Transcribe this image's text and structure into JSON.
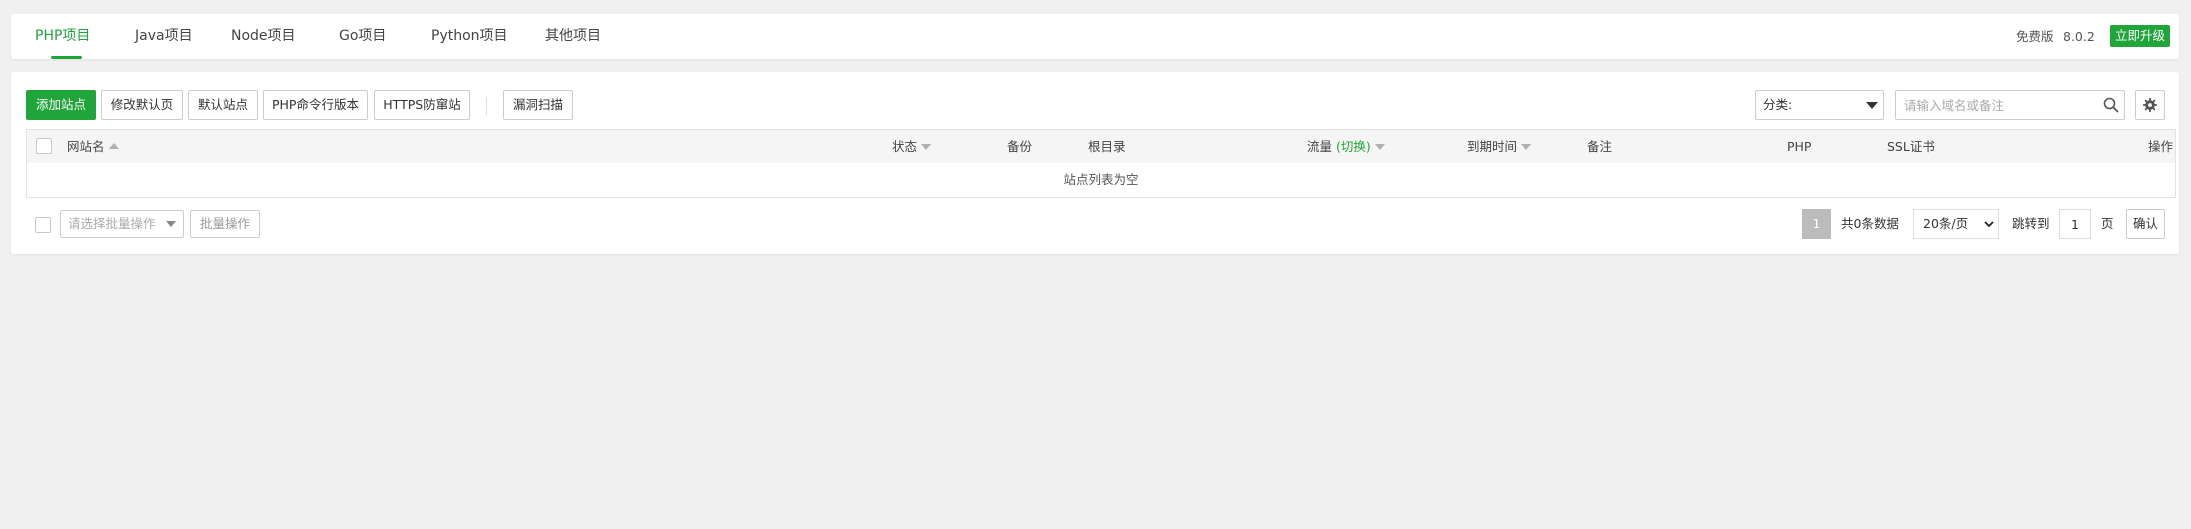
{
  "tabs": [
    {
      "label": "PHP项目",
      "active": true
    },
    {
      "label": "Java项目",
      "active": false
    },
    {
      "label": "Node项目",
      "active": false
    },
    {
      "label": "Go项目",
      "active": false
    },
    {
      "label": "Python项目",
      "active": false
    },
    {
      "label": "其他项目",
      "active": false
    }
  ],
  "version": {
    "edition": "免费版",
    "number": "8.0.2",
    "upgrade_label": "立即升级"
  },
  "toolbar": {
    "add_site": "添加站点",
    "edit_default_page": "修改默认页",
    "default_site": "默认站点",
    "php_cli_version": "PHP命令行版本",
    "https_protection": "HTTPS防窜站",
    "vuln_scan": "漏洞扫描",
    "category_label": "分类:",
    "search_placeholder": "请输入域名或备注"
  },
  "table": {
    "columns": {
      "site_name": "网站名",
      "status": "状态",
      "backup": "备份",
      "root_dir": "根目录",
      "traffic": "流量",
      "traffic_toggle": "(切换)",
      "expire_time": "到期时间",
      "remark": "备注",
      "php": "PHP",
      "ssl": "SSL证书",
      "actions": "操作"
    },
    "empty_text": "站点列表为空"
  },
  "footer": {
    "batch_placeholder": "请选择批量操作",
    "batch_button": "批量操作",
    "current_page": "1",
    "total_text": "共0条数据",
    "per_page": "20条/页",
    "jump_label": "跳转到",
    "jump_value": "1",
    "page_unit": "页",
    "confirm": "确认"
  },
  "colors": {
    "accent": "#20a53a",
    "background": "#f0f0f0",
    "page_active": "#bbbbbb"
  }
}
